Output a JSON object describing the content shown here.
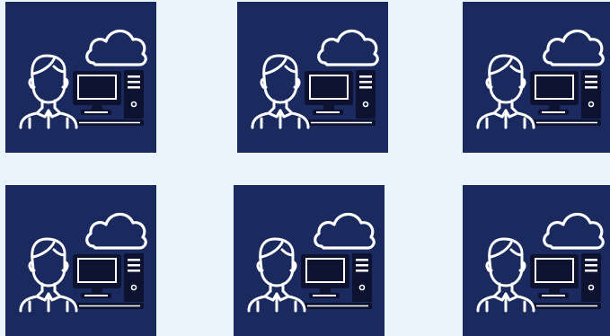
{
  "tile_background": "#1a2a5e",
  "stroke_color": "#ffffff",
  "computer_color": "#0c1230",
  "tiles": [
    {
      "icons": [
        "person-icon",
        "computer-icon",
        "cloud-icon"
      ]
    },
    {
      "icons": [
        "person-icon",
        "computer-icon",
        "cloud-icon"
      ]
    },
    {
      "icons": [
        "person-icon",
        "computer-icon",
        "cloud-icon"
      ]
    },
    {
      "icons": [
        "person-icon",
        "computer-icon",
        "cloud-icon"
      ]
    },
    {
      "icons": [
        "person-icon",
        "computer-icon",
        "cloud-icon"
      ]
    },
    {
      "icons": [
        "person-icon",
        "computer-icon",
        "cloud-icon"
      ]
    }
  ]
}
